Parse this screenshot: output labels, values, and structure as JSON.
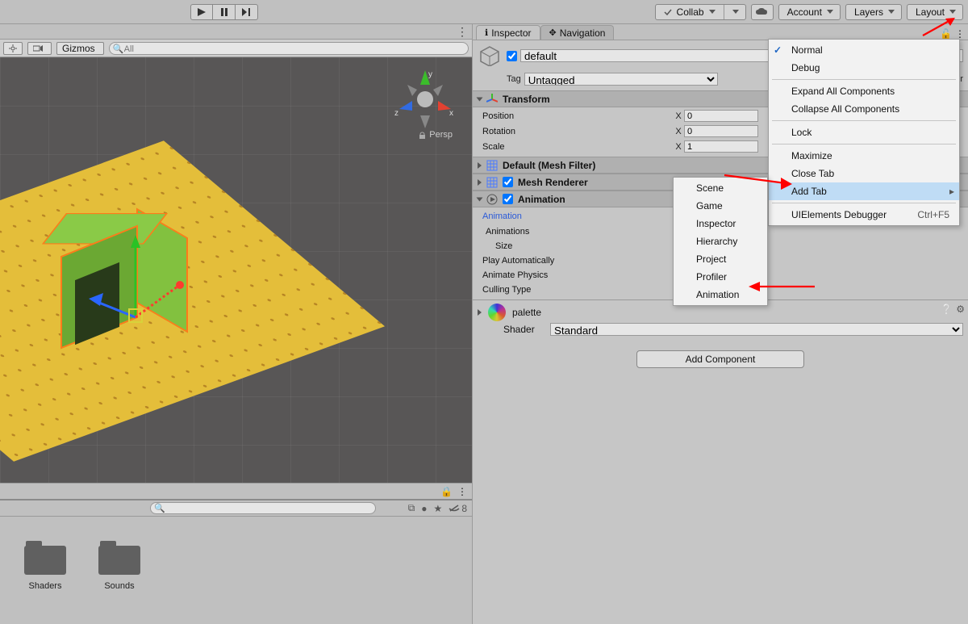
{
  "toolbar": {
    "collab": "Collab",
    "account": "Account",
    "layers": "Layers",
    "layout": "Layout"
  },
  "scene_toolbar": {
    "gizmos": "Gizmos",
    "search_placeholder": "All"
  },
  "viewport": {
    "persp": "Persp",
    "axis": {
      "x": "x",
      "y": "y",
      "z": "z"
    }
  },
  "scene_status": {
    "visible_count": "8"
  },
  "project": {
    "folders": [
      "Shaders",
      "Sounds"
    ]
  },
  "inspector": {
    "tab_inspector": "Inspector",
    "tab_navigation": "Navigation",
    "go_name": "default",
    "tag_label": "Tag",
    "tag_value": "Untagged",
    "layer_label": "Layer",
    "transform": {
      "title": "Transform",
      "position_label": "Position",
      "rotation_label": "Rotation",
      "scale_label": "Scale",
      "axis_x": "X",
      "pos_x": "0",
      "rot_x": "0",
      "scale_x": "1"
    },
    "meshfilter": {
      "title": "Default (Mesh Filter)"
    },
    "meshrenderer": {
      "title": "Mesh Renderer"
    },
    "animation": {
      "title": "Animation",
      "link": "Animation",
      "animations_label": "Animations",
      "size_label": "Size",
      "play_auto": "Play Automatically",
      "animate_physics": "Animate Physics",
      "culling_type": "Culling Type"
    },
    "material": {
      "name": "palette",
      "shader_label": "Shader",
      "shader_value": "Standard"
    },
    "add_component": "Add Component"
  },
  "menu_main": {
    "normal": "Normal",
    "debug": "Debug",
    "expand": "Expand All Components",
    "collapse": "Collapse All Components",
    "lock": "Lock",
    "maximize": "Maximize",
    "close_tab": "Close Tab",
    "add_tab": "Add Tab",
    "debugger": "UIElements Debugger",
    "debugger_short": "Ctrl+F5"
  },
  "menu_sub": {
    "scene": "Scene",
    "game": "Game",
    "inspector": "Inspector",
    "hierarchy": "Hierarchy",
    "project": "Project",
    "profiler": "Profiler",
    "animation": "Animation"
  }
}
